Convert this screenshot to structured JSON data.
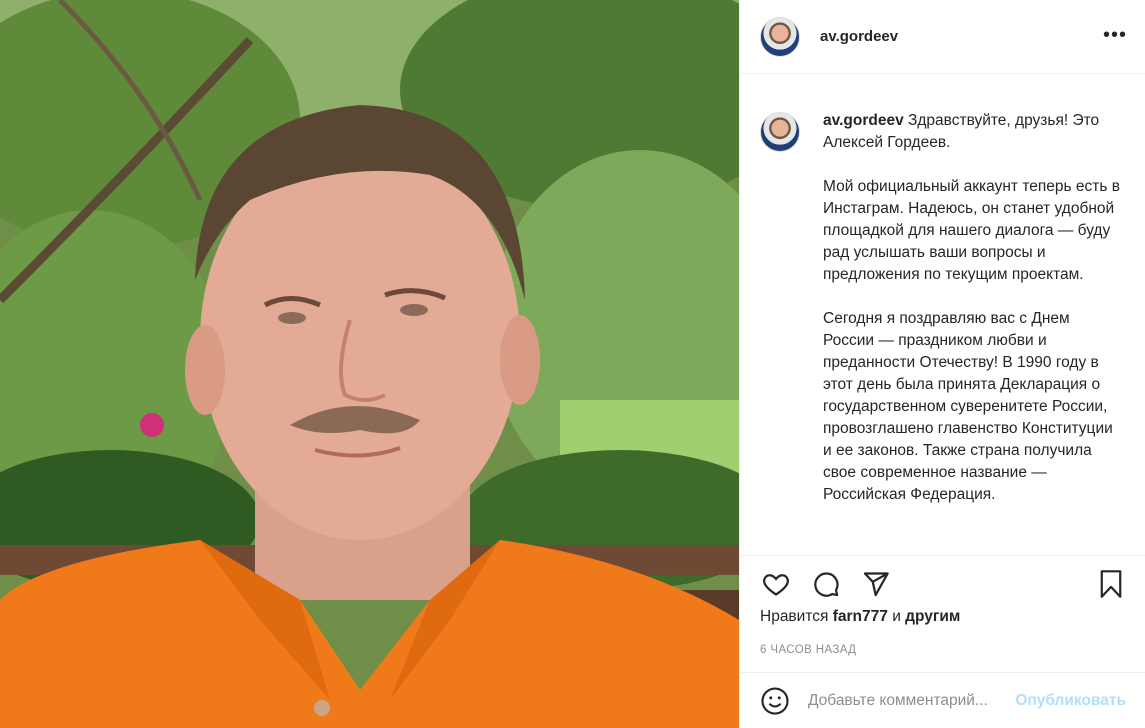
{
  "post": {
    "username": "av.gordeev",
    "caption": {
      "username": "av.gordeev",
      "text": "Здравствуйте, друзья! Это Алексей Гордеев.\n\nМой официальный аккаунт теперь есть в Инстаграм. Надеюсь, он станет удобной площадкой для нашего диалога — буду рад услышать ваши вопросы и предложения по текущим проектам.\n\nСегодня я поздравляю вас с Днем России — праздником любви и преданности Отечеству! В 1990 году в этот день была принята Декларация о государственном суверенитете России, провозглашено главенство Конституции и ее законов. Также страна получила свое современное название — Российская Федерация."
    },
    "likes": {
      "prefix": "Нравится",
      "user": "farn777",
      "middle": "и",
      "others": "другим"
    },
    "timestamp": "6 ЧАСОВ НАЗАД",
    "comment": {
      "placeholder": "Добавьте комментарий...",
      "publish_label": "Опубликовать"
    }
  },
  "icons": {
    "more": "more-horizontal-icon",
    "like": "heart-icon",
    "comment": "comment-bubble-icon",
    "share": "paper-plane-icon",
    "save": "bookmark-icon",
    "emoji": "smiley-icon"
  },
  "colors": {
    "text": "#262626",
    "secondary": "#8e8e8e",
    "divider": "#efefef",
    "publish_disabled": "#b2dffc",
    "shirt": "#f07a1a"
  }
}
